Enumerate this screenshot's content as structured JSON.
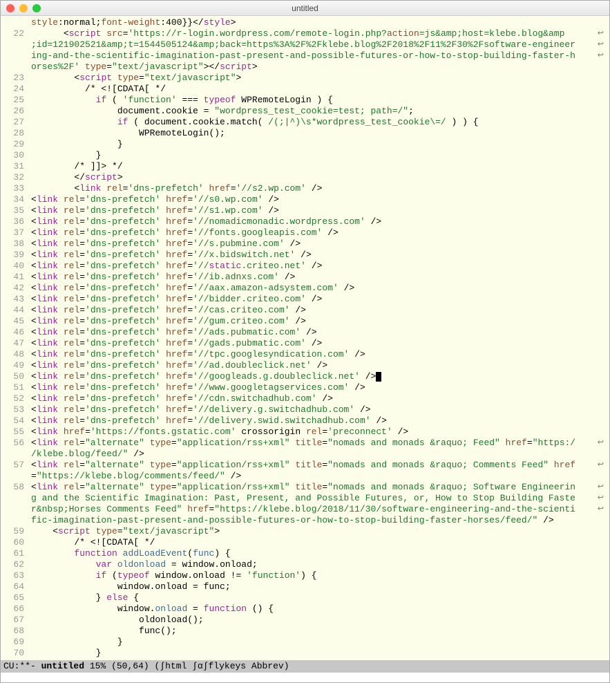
{
  "window": {
    "title": "untitled"
  },
  "first_line_number": 22,
  "lines": [
    {
      "n": null,
      "html": "<span class='c-attr'>style</span>:<span class='c-txt'>normal</span>;<span class='c-attr'>font-weight</span>:<span class='c-txt'>400</span>}}&lt;/<span class='c-key'>style</span>&gt;"
    },
    {
      "n": 22,
      "html": "      &lt;<span class='c-key'>script</span> <span class='c-attr'>src</span>=<span class='c-str'>'https://r-login.wordpress.com/remote-login.php?</span><span class='c-attr'>action</span><span class='c-str'>=js&amp;amp;host=klebe.blog&amp;amp</span><span class='cont'>↩</span>"
    },
    {
      "n": null,
      "html": "<span class='c-str'>;id=121902521&amp;amp;t=1544505124&amp;amp;back=https%3A%2F%2Fklebe.blog%2F2018%2F11%2F30%2Fsoftware-engineer</span><span class='cont'>↩</span>"
    },
    {
      "n": null,
      "html": "<span class='c-str'>ing-and-the-scientific-imagination-past-present-and-possible-futures-or-how-to-stop-building-faster-h</span><span class='cont'>↩</span>"
    },
    {
      "n": null,
      "html": "<span class='c-str'>orses%2F'</span> <span class='c-attr'>type</span>=<span class='c-str'>\"text/javascript\"</span>&gt;&lt;/<span class='c-key'>script</span>&gt;"
    },
    {
      "n": 23,
      "html": "        &lt;<span class='c-key'>script</span> <span class='c-attr'>type</span>=<span class='c-str'>\"text/javascript\"</span>&gt;"
    },
    {
      "n": 24,
      "html": "          /* &lt;![CDATA[ */"
    },
    {
      "n": 25,
      "html": "            <span class='c-kw2'>if</span> ( <span class='c-str'>'function'</span> === <span class='c-kw2'>typeof</span> WPRemoteLogin ) {"
    },
    {
      "n": 26,
      "html": "                document.cookie = <span class='c-str'>\"wordpress_test_cookie=test; path=/\"</span>;"
    },
    {
      "n": 27,
      "html": "                <span class='c-kw2'>if</span> ( document.cookie.match( <span class='c-str'>/(;|^)\\s*wordpress_test_cookie\\=/</span> ) ) {"
    },
    {
      "n": 28,
      "html": "                    WPRemoteLogin();"
    },
    {
      "n": 29,
      "html": "                }"
    },
    {
      "n": 30,
      "html": "            }"
    },
    {
      "n": 31,
      "html": "        /* ]]&gt; */"
    },
    {
      "n": 32,
      "html": "        &lt;/<span class='c-key'>script</span>&gt;"
    },
    {
      "n": 33,
      "html": "        &lt;<span class='c-key'>link</span> <span class='c-attr'>rel</span>=<span class='c-str'>'dns-prefetch'</span> <span class='c-attr'>href</span>=<span class='c-str'>'//s2.wp.com'</span> /&gt;"
    },
    {
      "n": 34,
      "html": "&lt;<span class='c-key'>link</span> <span class='c-attr'>rel</span>=<span class='c-str'>'dns-prefetch'</span> <span class='c-attr'>href</span>=<span class='c-str'>'//s0.wp.com'</span> /&gt;"
    },
    {
      "n": 35,
      "html": "&lt;<span class='c-key'>link</span> <span class='c-attr'>rel</span>=<span class='c-str'>'dns-prefetch'</span> <span class='c-attr'>href</span>=<span class='c-str'>'//s1.wp.com'</span> /&gt;"
    },
    {
      "n": 36,
      "html": "&lt;<span class='c-key'>link</span> <span class='c-attr'>rel</span>=<span class='c-str'>'dns-prefetch'</span> <span class='c-attr'>href</span>=<span class='c-str'>'//nomadicmonadic.wordpress.com'</span> /&gt;"
    },
    {
      "n": 37,
      "html": "&lt;<span class='c-key'>link</span> <span class='c-attr'>rel</span>=<span class='c-str'>'dns-prefetch'</span> <span class='c-attr'>href</span>=<span class='c-str'>'//fonts.googleapis.com'</span> /&gt;"
    },
    {
      "n": 38,
      "html": "&lt;<span class='c-key'>link</span> <span class='c-attr'>rel</span>=<span class='c-str'>'dns-prefetch'</span> <span class='c-attr'>href</span>=<span class='c-str'>'//s.pubmine.com'</span> /&gt;"
    },
    {
      "n": 39,
      "html": "&lt;<span class='c-key'>link</span> <span class='c-attr'>rel</span>=<span class='c-str'>'dns-prefetch'</span> <span class='c-attr'>href</span>=<span class='c-str'>'//x.bidswitch.net'</span> /&gt;"
    },
    {
      "n": 40,
      "html": "&lt;<span class='c-key'>link</span> <span class='c-attr'>rel</span>=<span class='c-str'>'dns-prefetch'</span> <span class='c-attr'>href</span>=<span class='c-str'>'//</span><span class='c-kw2'>static</span><span class='c-str'>.criteo.net'</span> /&gt;"
    },
    {
      "n": 41,
      "html": "&lt;<span class='c-key'>link</span> <span class='c-attr'>rel</span>=<span class='c-str'>'dns-prefetch'</span> <span class='c-attr'>href</span>=<span class='c-str'>'//ib.adnxs.com'</span> /&gt;"
    },
    {
      "n": 42,
      "html": "&lt;<span class='c-key'>link</span> <span class='c-attr'>rel</span>=<span class='c-str'>'dns-prefetch'</span> <span class='c-attr'>href</span>=<span class='c-str'>'//aax.amazon-adsystem.com'</span> /&gt;"
    },
    {
      "n": 43,
      "html": "&lt;<span class='c-key'>link</span> <span class='c-attr'>rel</span>=<span class='c-str'>'dns-prefetch'</span> <span class='c-attr'>href</span>=<span class='c-str'>'//bidder.criteo.com'</span> /&gt;"
    },
    {
      "n": 44,
      "html": "&lt;<span class='c-key'>link</span> <span class='c-attr'>rel</span>=<span class='c-str'>'dns-prefetch'</span> <span class='c-attr'>href</span>=<span class='c-str'>'//cas.criteo.com'</span> /&gt;"
    },
    {
      "n": 45,
      "html": "&lt;<span class='c-key'>link</span> <span class='c-attr'>rel</span>=<span class='c-str'>'dns-prefetch'</span> <span class='c-attr'>href</span>=<span class='c-str'>'//gum.criteo.com'</span> /&gt;"
    },
    {
      "n": 46,
      "html": "&lt;<span class='c-key'>link</span> <span class='c-attr'>rel</span>=<span class='c-str'>'dns-prefetch'</span> <span class='c-attr'>href</span>=<span class='c-str'>'//ads.pubmatic.com'</span> /&gt;"
    },
    {
      "n": 47,
      "html": "&lt;<span class='c-key'>link</span> <span class='c-attr'>rel</span>=<span class='c-str'>'dns-prefetch'</span> <span class='c-attr'>href</span>=<span class='c-str'>'//gads.pubmatic.com'</span> /&gt;"
    },
    {
      "n": 48,
      "html": "&lt;<span class='c-key'>link</span> <span class='c-attr'>rel</span>=<span class='c-str'>'dns-prefetch'</span> <span class='c-attr'>href</span>=<span class='c-str'>'//tpc.googlesyndication.com'</span> /&gt;"
    },
    {
      "n": 49,
      "html": "&lt;<span class='c-key'>link</span> <span class='c-attr'>rel</span>=<span class='c-str'>'dns-prefetch'</span> <span class='c-attr'>href</span>=<span class='c-str'>'//ad.doubleclick.net'</span> /&gt;"
    },
    {
      "n": 50,
      "html": "&lt;<span class='c-key'>link</span> <span class='c-attr'>rel</span>=<span class='c-str'>'dns-prefetch'</span> <span class='c-attr'>href</span>=<span class='c-str'>'//googleads.g.doubleclick.net'</span> /&gt;<span class='cursor'></span>"
    },
    {
      "n": 51,
      "html": "&lt;<span class='c-key'>link</span> <span class='c-attr'>rel</span>=<span class='c-str'>'dns-prefetch'</span> <span class='c-attr'>href</span>=<span class='c-str'>'//www.googletagservices.com'</span> /&gt;"
    },
    {
      "n": 52,
      "html": "&lt;<span class='c-key'>link</span> <span class='c-attr'>rel</span>=<span class='c-str'>'dns-prefetch'</span> <span class='c-attr'>href</span>=<span class='c-str'>'//cdn.switchadhub.com'</span> /&gt;"
    },
    {
      "n": 53,
      "html": "&lt;<span class='c-key'>link</span> <span class='c-attr'>rel</span>=<span class='c-str'>'dns-prefetch'</span> <span class='c-attr'>href</span>=<span class='c-str'>'//delivery.g.switchadhub.com'</span> /&gt;"
    },
    {
      "n": 54,
      "html": "&lt;<span class='c-key'>link</span> <span class='c-attr'>rel</span>=<span class='c-str'>'dns-prefetch'</span> <span class='c-attr'>href</span>=<span class='c-str'>'//delivery.swid.switchadhub.com'</span> /&gt;"
    },
    {
      "n": 55,
      "html": "&lt;<span class='c-key'>link</span> <span class='c-attr'>href</span>=<span class='c-str'>'https://fonts.gstatic.com'</span> crossorigin <span class='c-attr'>rel</span>=<span class='c-str'>'preconnect'</span> /&gt;"
    },
    {
      "n": 56,
      "html": "&lt;<span class='c-key'>link</span> <span class='c-attr'>rel</span>=<span class='c-str'>\"alternate\"</span> <span class='c-attr'>type</span>=<span class='c-str'>\"application/rss+xml\"</span> <span class='c-attr'>title</span>=<span class='c-str'>\"nomads and monads &amp;raquo; Feed\"</span> <span class='c-attr'>href</span>=<span class='c-str'>\"https:/</span><span class='cont'>↩</span>"
    },
    {
      "n": null,
      "html": "<span class='c-str'>/klebe.blog/feed/\"</span> /&gt;"
    },
    {
      "n": 57,
      "html": "&lt;<span class='c-key'>link</span> <span class='c-attr'>rel</span>=<span class='c-str'>\"alternate\"</span> <span class='c-attr'>type</span>=<span class='c-str'>\"application/rss+xml\"</span> <span class='c-attr'>title</span>=<span class='c-str'>\"nomads and monads &amp;raquo; Comments Feed\"</span> <span class='c-attr'>href</span><span class='cont'>↩</span>"
    },
    {
      "n": null,
      "html": "=<span class='c-str'>\"https://klebe.blog/comments/feed/\"</span> /&gt;"
    },
    {
      "n": 58,
      "html": "&lt;<span class='c-key'>link</span> <span class='c-attr'>rel</span>=<span class='c-str'>\"alternate\"</span> <span class='c-attr'>type</span>=<span class='c-str'>\"application/rss+xml\"</span> <span class='c-attr'>title</span>=<span class='c-str'>\"nomads and monads &amp;raquo; Software Engineerin</span><span class='cont'>↩</span>"
    },
    {
      "n": null,
      "html": "<span class='c-str'>g and the Scientific Imagination: Past, Present, and Possible Futures, or, How to Stop Building Faste</span><span class='cont'>↩</span>"
    },
    {
      "n": null,
      "html": "<span class='c-str'>r&amp;nbsp;Horses Comments Feed\"</span> <span class='c-attr'>href</span>=<span class='c-str'>\"https://klebe.blog/2018/11/30/software-engineering-and-the-scienti</span><span class='cont'>↩</span>"
    },
    {
      "n": null,
      "html": "<span class='c-str'>fic-imagination-past-present-and-possible-futures-or-how-to-stop-building-faster-horses/feed/\"</span> /&gt;"
    },
    {
      "n": 59,
      "html": "    &lt;<span class='c-key'>script</span> <span class='c-attr'>type</span>=<span class='c-str'>\"text/javascript\"</span>&gt;"
    },
    {
      "n": 60,
      "html": "        /* &lt;![CDATA[ */"
    },
    {
      "n": 61,
      "html": "        <span class='c-kw2'>function</span> <span class='c-var'>addLoadEvent</span>(<span class='c-var'>func</span>) {"
    },
    {
      "n": 62,
      "html": "            <span class='c-kw2'>var</span> <span class='c-var'>oldonload</span> = window.onload;"
    },
    {
      "n": 63,
      "html": "            <span class='c-kw2'>if</span> (<span class='c-kw2'>typeof</span> window.onload != <span class='c-str'>'function'</span>) {"
    },
    {
      "n": 64,
      "html": "                window.onload = func;"
    },
    {
      "n": 65,
      "html": "            } <span class='c-kw2'>else</span> {"
    },
    {
      "n": 66,
      "html": "                window.<span class='c-var'>onload</span> = <span class='c-kw2'>function</span> () {"
    },
    {
      "n": 67,
      "html": "                    oldonload();"
    },
    {
      "n": 68,
      "html": "                    func();"
    },
    {
      "n": 69,
      "html": "                }"
    },
    {
      "n": 70,
      "html": "            }"
    }
  ],
  "modeline": {
    "left": "CU:**-  ",
    "buffer": "untitled",
    "percent": "15%",
    "pos": "(50,64)",
    "modes": "(∫html ∫α∫flykeys Abbrev)"
  }
}
